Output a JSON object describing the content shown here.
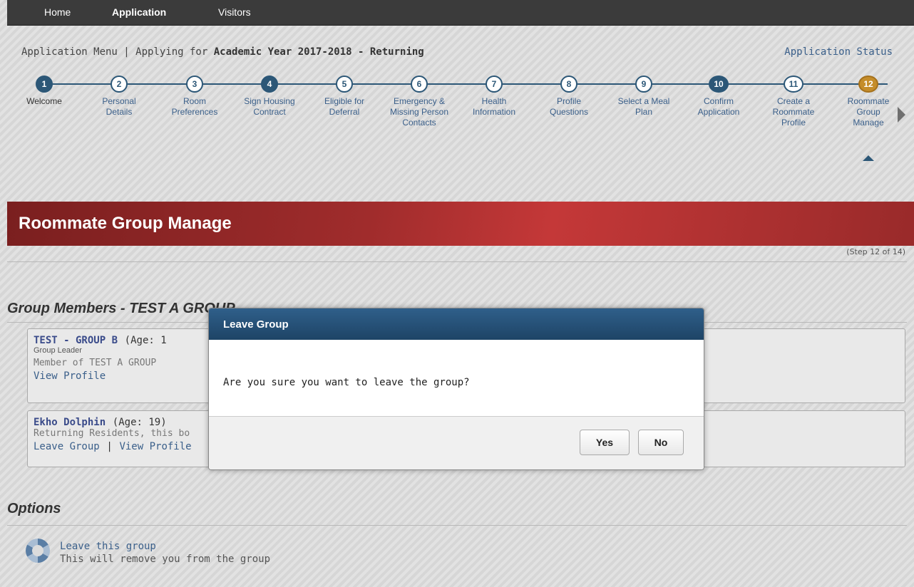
{
  "nav": {
    "home": "Home",
    "application": "Application",
    "visitors": "Visitors"
  },
  "app_menu": {
    "prefix": "Application Menu | Applying for ",
    "year": "Academic Year 2017-2018 - Returning",
    "status_link": "Application Status"
  },
  "steps": [
    {
      "num": "1",
      "label": "Welcome",
      "state": "done"
    },
    {
      "num": "2",
      "label": "Personal Details",
      "state": "todo"
    },
    {
      "num": "3",
      "label": "Room Preferences",
      "state": "todo"
    },
    {
      "num": "4",
      "label": "Sign Housing Contract",
      "state": "done"
    },
    {
      "num": "5",
      "label": "Eligible for Deferral",
      "state": "todo"
    },
    {
      "num": "6",
      "label": "Emergency & Missing Person Contacts",
      "state": "todo"
    },
    {
      "num": "7",
      "label": "Health Information",
      "state": "todo"
    },
    {
      "num": "8",
      "label": "Profile Questions",
      "state": "todo"
    },
    {
      "num": "9",
      "label": "Select a Meal Plan",
      "state": "todo"
    },
    {
      "num": "10",
      "label": "Confirm Application",
      "state": "done"
    },
    {
      "num": "11",
      "label": "Create a Roommate Profile",
      "state": "todo"
    },
    {
      "num": "12",
      "label": "Roommate Group Manage",
      "state": "current"
    }
  ],
  "page": {
    "title": "Roommate Group Manage",
    "step_count": "(Step 12 of 14)"
  },
  "group": {
    "title": "Group Members - TEST A GROUP",
    "members": [
      {
        "name": "TEST - GROUP B",
        "age": "(Age: 1",
        "role": "Group Leader",
        "text": "Member of TEST A GROUP",
        "link1": "View Profile"
      },
      {
        "name": "Ekho Dolphin",
        "age": "(Age: 19)",
        "text": "Returning Residents, this bo",
        "link1": "Leave Group",
        "separator": "|",
        "link2": "View Profile"
      }
    ]
  },
  "options": {
    "title": "Options",
    "leave_link": "Leave this group",
    "leave_desc": "This will remove you from the group"
  },
  "modal": {
    "title": "Leave Group",
    "message": "Are you sure you want to leave the group?",
    "yes": "Yes",
    "no": "No"
  },
  "colors": {
    "nav_bg": "#3b3b3b",
    "step_blue": "#2c5777",
    "step_current": "#c58d2a",
    "banner_red": "#a02c2c",
    "modal_header": "#1e4466",
    "link_blue": "#3a5f8a"
  }
}
